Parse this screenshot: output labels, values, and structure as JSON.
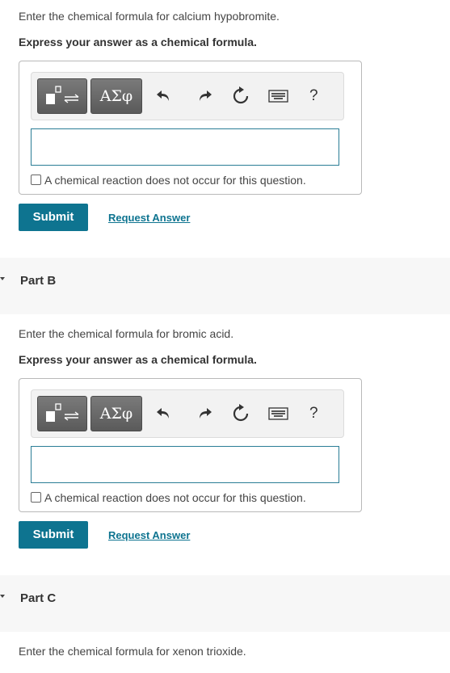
{
  "part_a": {
    "prompt": "Enter the chemical formula for calcium hypobromite.",
    "instruction": "Express your answer as a chemical formula.",
    "toolbar": {
      "greek_label": "ΑΣφ",
      "help_label": "?"
    },
    "input_value": "",
    "no_reaction_label": "A chemical reaction does not occur for this question.",
    "submit_label": "Submit",
    "request_answer_label": "Request Answer"
  },
  "part_b": {
    "title": "Part B",
    "prompt": "Enter the chemical formula for bromic acid.",
    "instruction": "Express your answer as a chemical formula.",
    "toolbar": {
      "greek_label": "ΑΣφ",
      "help_label": "?"
    },
    "input_value": "",
    "no_reaction_label": "A chemical reaction does not occur for this question.",
    "submit_label": "Submit",
    "request_answer_label": "Request Answer"
  },
  "part_c": {
    "title": "Part C",
    "prompt": "Enter the chemical formula for xenon trioxide."
  },
  "icons": [
    "templates-icon",
    "undo-icon",
    "redo-icon",
    "reset-icon",
    "keyboard-icon",
    "help-icon",
    "caret-down-icon"
  ],
  "colors": {
    "accent": "#0e7490",
    "input_border": "#2a7d96",
    "toolbar_button": "#666666"
  }
}
